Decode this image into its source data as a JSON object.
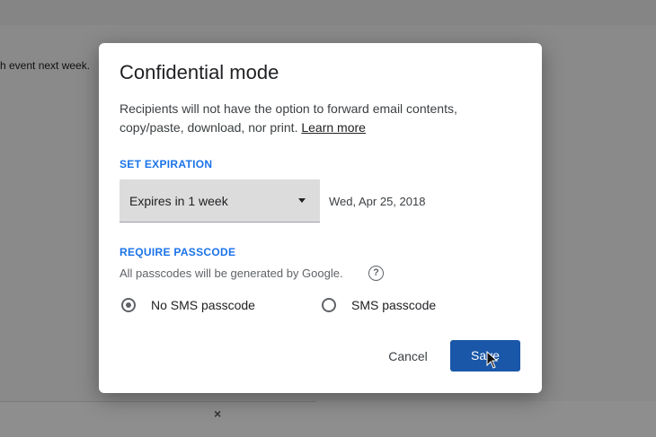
{
  "background": {
    "snippet_text": "h event next week.",
    "close_glyph": "×"
  },
  "dialog": {
    "title": "Confidential mode",
    "description": "Recipients will not have the option to forward email contents, copy/paste, download, nor print.",
    "learn_more": "Learn more",
    "set_expiration_label": "SET EXPIRATION",
    "expiry_select_value": "Expires in 1 week",
    "expiry_date": "Wed, Apr 25, 2018",
    "require_passcode_label": "REQUIRE PASSCODE",
    "passcode_note": "All passcodes will be generated by Google.",
    "help_glyph": "?",
    "options": [
      {
        "label": "No SMS passcode",
        "selected": true
      },
      {
        "label": "SMS passcode",
        "selected": false
      }
    ],
    "cancel_label": "Cancel",
    "save_label": "Save"
  },
  "colors": {
    "accent": "#1a73e8",
    "save_button": "#1a57a8",
    "overlay": "#8a8a8a"
  }
}
